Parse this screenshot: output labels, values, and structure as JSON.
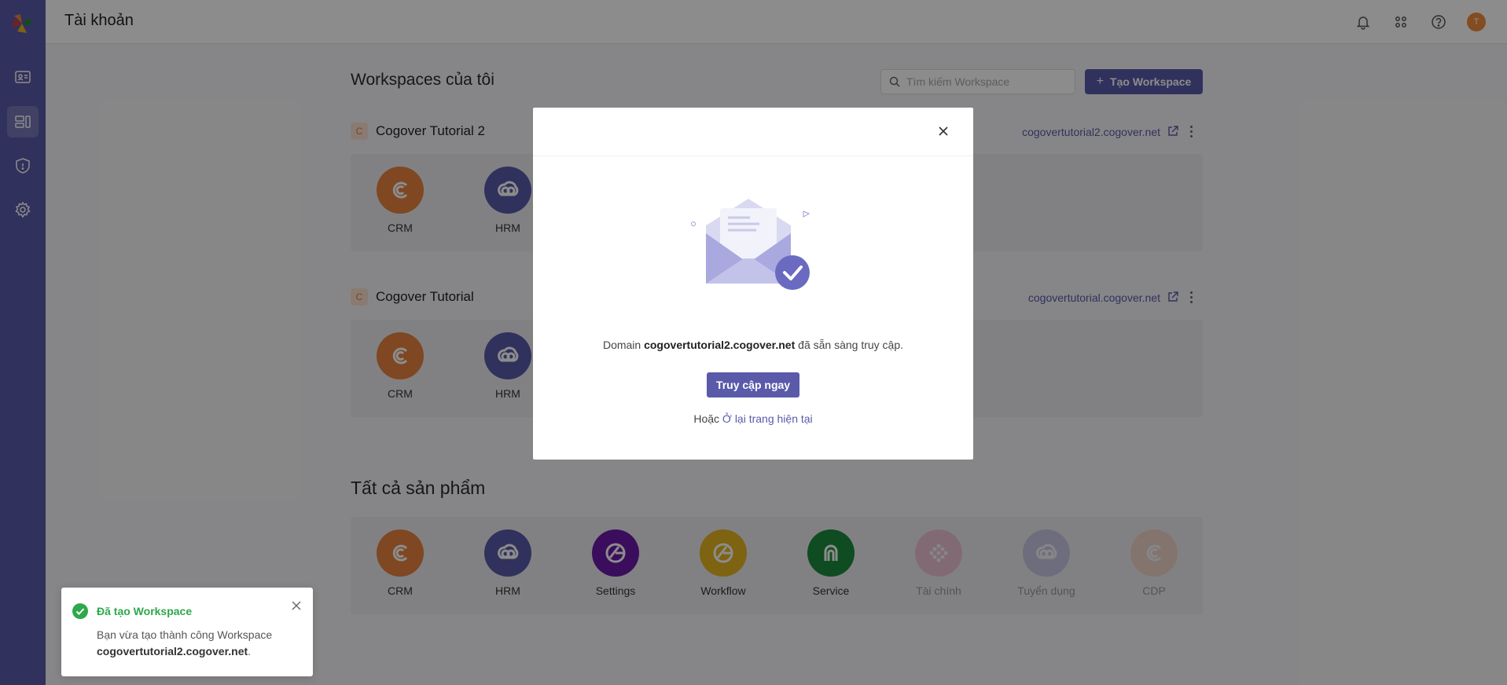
{
  "header": {
    "title": "Tài khoản",
    "avatar_initial": "T"
  },
  "sidebar": {
    "items": [
      {
        "name": "contact-card-icon"
      },
      {
        "name": "workspace-layout-icon",
        "active": true
      },
      {
        "name": "shield-icon"
      },
      {
        "name": "gear-icon"
      }
    ]
  },
  "workspaces": {
    "title": "Workspaces của tôi",
    "search_placeholder": "Tìm kiếm Workspace",
    "create_label": "Tạo Workspace",
    "items": [
      {
        "badge": "C",
        "name": "Cogover Tutorial 2",
        "domain": "cogovertutorial2.cogover.net",
        "apps": [
          "CRM",
          "HRM"
        ]
      },
      {
        "badge": "C",
        "name": "Cogover Tutorial",
        "domain": "cogovertutorial.cogover.net",
        "apps": [
          "CRM",
          "HRM"
        ]
      }
    ]
  },
  "products": {
    "title": "Tất cả sản phẩm",
    "items": [
      "CRM",
      "HRM",
      "Settings",
      "Workflow",
      "Service",
      "Tài chính",
      "Tuyển dụng",
      "CDP"
    ]
  },
  "modal": {
    "msg_prefix": "Domain",
    "msg_domain": "cogovertutorial2.cogover.net",
    "msg_suffix": "đã sẵn sàng truy cập.",
    "primary_label": "Truy cập ngay",
    "or_prefix": "Hoặc",
    "stay_link": "Ở lại trang hiện tại"
  },
  "toast": {
    "title": "Đã tạo Workspace",
    "body_prefix": "Bạn vừa tạo thành công Workspace",
    "body_domain": "cogovertutorial2.cogover.net",
    "body_suffix": "."
  },
  "colors": {
    "brand": "#5a5aaa",
    "crm": "#e8823f",
    "hrm": "#5a5aaa",
    "settings": "#6a1aa8",
    "workflow": "#e3b521",
    "service": "#1e8a3c",
    "finance": "#f08fb4",
    "recruit": "#9b9bd6",
    "cdp": "#f3b99a",
    "success": "#2ea84b"
  }
}
